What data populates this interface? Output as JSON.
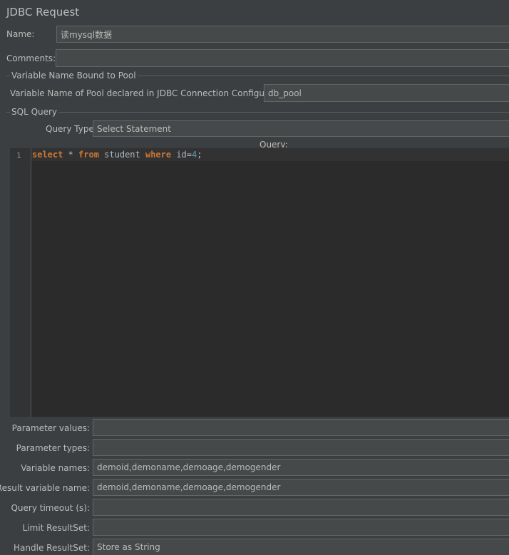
{
  "panel": {
    "title": "JDBC Request"
  },
  "name": {
    "label": "Name:",
    "value": "读mysql数据"
  },
  "comments": {
    "label": "Comments:",
    "value": ""
  },
  "pool_section": {
    "title": "Variable Name Bound to Pool",
    "label": "Variable Name of Pool declared in JDBC Connection Configuration:",
    "value": "db_pool"
  },
  "sql_section": {
    "title": "SQL Query",
    "query_type_label": "Query Type:",
    "query_type_value": "Select Statement",
    "query_label": "Query:",
    "line_number": "1",
    "code": {
      "kw_select": "select",
      "t1": " * ",
      "kw_from": "from",
      "t2": " student ",
      "kw_where": "where",
      "t3": " id=",
      "num": "4",
      "t4": ";"
    }
  },
  "params": [
    {
      "label": "Parameter values:",
      "value": ""
    },
    {
      "label": "Parameter types:",
      "value": ""
    },
    {
      "label": "Variable names:",
      "value": "demoid,demoname,demoage,demogender"
    },
    {
      "label": "Result variable name:",
      "value": "demoid,demoname,demoage,demogender"
    },
    {
      "label": "Query timeout (s):",
      "value": ""
    },
    {
      "label": "Limit ResultSet:",
      "value": ""
    },
    {
      "label": "Handle ResultSet:",
      "value": "Store as String"
    }
  ],
  "colors": {
    "background": "#3c3f41",
    "field": "#45494a",
    "editor": "#2b2b2b",
    "keyword": "#cc7832",
    "number": "#6897bb"
  }
}
